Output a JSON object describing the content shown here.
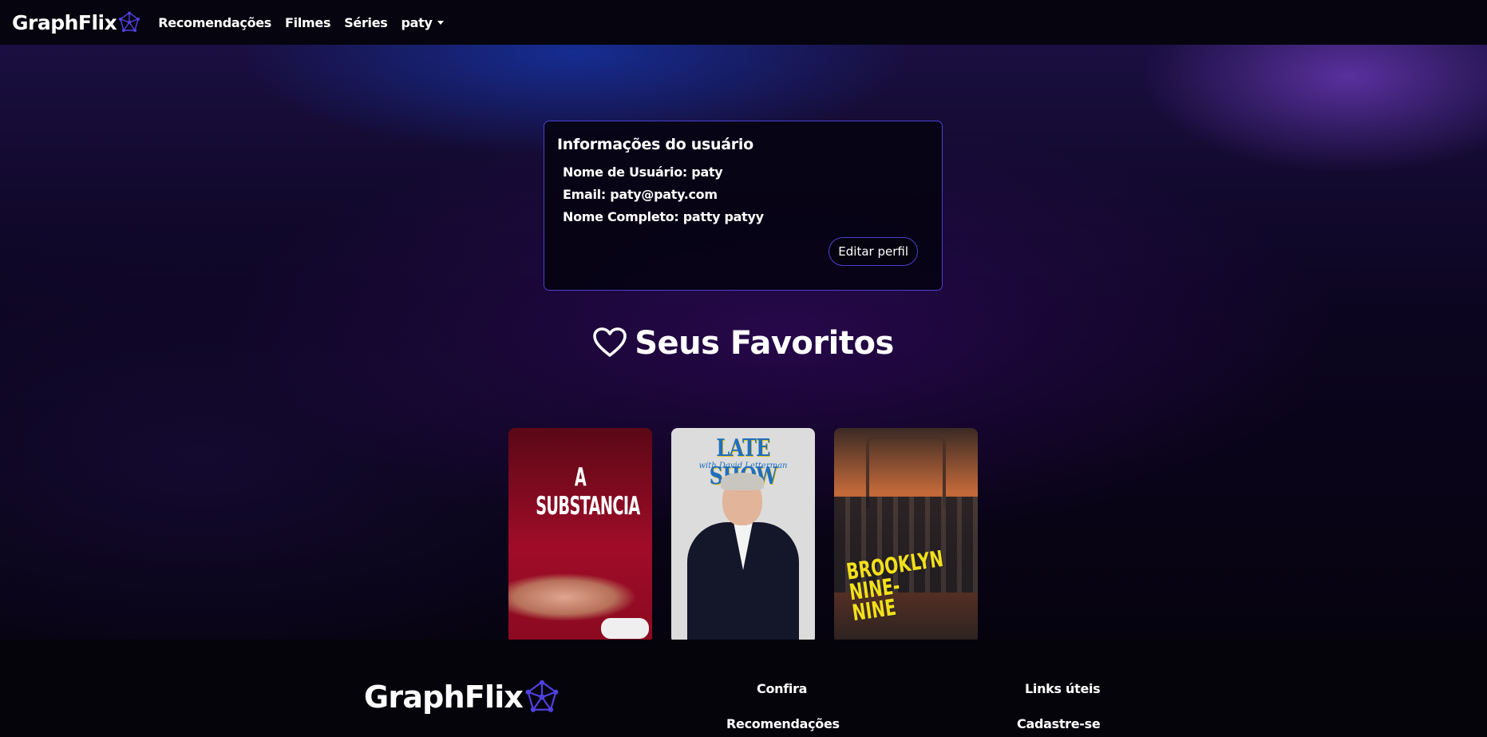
{
  "navbar": {
    "brand": "GraphFlix",
    "brand_icon": "network-graph-icon",
    "links": [
      "Recomendações",
      "Filmes",
      "Séries"
    ],
    "user_menu": "paty"
  },
  "user_info": {
    "title": "Informações do usuário",
    "username_line": "Nome de Usuário: paty",
    "email_line": "Email: paty@paty.com",
    "fullname_line": "Nome Completo: patty patyy",
    "edit_button": "Editar perfil"
  },
  "favorites": {
    "heading": "Seus Favoritos",
    "icon": "heart-outline-icon",
    "posters": [
      {
        "title": "A SUBSTANCIA",
        "subtitle": ""
      },
      {
        "title": "LATE SHOW",
        "subtitle": "with David Letterman"
      },
      {
        "title": "BROOKLYN NINE-NINE",
        "subtitle": ""
      }
    ]
  },
  "footer": {
    "brand": "GraphFlix",
    "col1_title": "Confira",
    "col1_link": "Recomendações",
    "col2_title": "Links úteis",
    "col2_link": "Cadastre-se"
  },
  "colors": {
    "accent_border": "#4b3fd0",
    "brand_icon": "#4a3fd8",
    "background": "#05030f"
  }
}
